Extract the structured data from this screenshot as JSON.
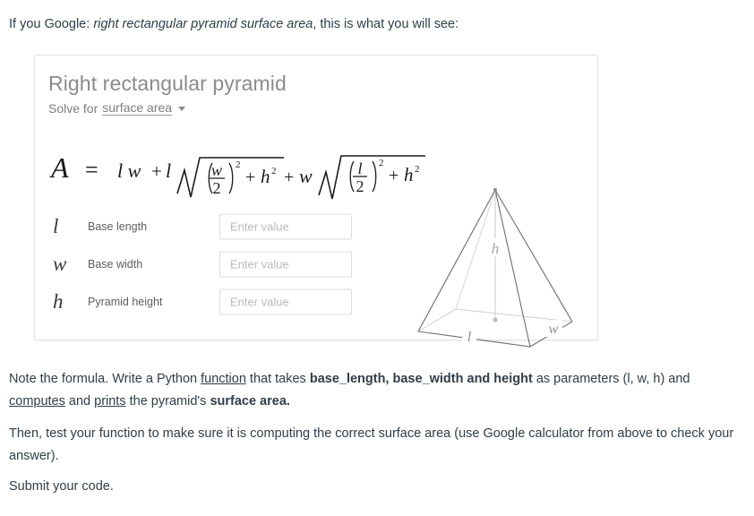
{
  "intro": {
    "before": "If you Google: ",
    "query": "right rectangular pyramid surface area",
    "after": ", this is what you will see:"
  },
  "card": {
    "title": "Right rectangular pyramid",
    "solve_for_label": "Solve for",
    "solve_for_value": "surface area",
    "caret_icon": "chevron-down-icon",
    "formula": {
      "text": "A = lw + l√((w/2)² + h²) + w√((l/2)² + h²)",
      "result_symbol": "A",
      "equals": "=",
      "term1": "l w + l",
      "frac1_num": "w",
      "frac1_den": "2",
      "exp1": "2",
      "plus_h1": "+h",
      "h1_exp": "2",
      "term2": "+ w",
      "frac2_num": "l",
      "frac2_den": "2",
      "exp2": "2",
      "plus_h2": "+h",
      "h2_exp": "2"
    },
    "variables": [
      {
        "symbol": "l",
        "name": "Base length",
        "value": "",
        "placeholder": "Enter value"
      },
      {
        "symbol": "w",
        "name": "Base width",
        "value": "",
        "placeholder": "Enter value"
      },
      {
        "symbol": "h",
        "name": "Pyramid height",
        "value": "",
        "placeholder": "Enter value"
      }
    ],
    "diagram": {
      "name": "right-rectangular-pyramid-diagram",
      "labels": {
        "height": "h",
        "length": "l",
        "width": "w"
      }
    }
  },
  "paragraphs": {
    "p1": {
      "s1": "Note the formula. Write a Python ",
      "link1": "function",
      "s2": " that takes ",
      "b1": "base_length, base_width and height",
      "s3": " as parameters (l, w, h) and ",
      "link2": "computes",
      "s4": " and ",
      "link3": "prints",
      "s5": " the pyramid's ",
      "b2": "surface area."
    },
    "p2": "Then, test your function to make sure it is computing the correct surface area (use Google calculator from above to check your answer).",
    "p3": "Submit your code."
  },
  "colors": {
    "text": "#2f3d4a",
    "card_title": "#8b8b8b",
    "card_border": "#e4e4e4",
    "placeholder": "#b9b9b9",
    "diagram_stroke": "#6e6e6e",
    "diagram_hidden": "#c8c8c8"
  }
}
